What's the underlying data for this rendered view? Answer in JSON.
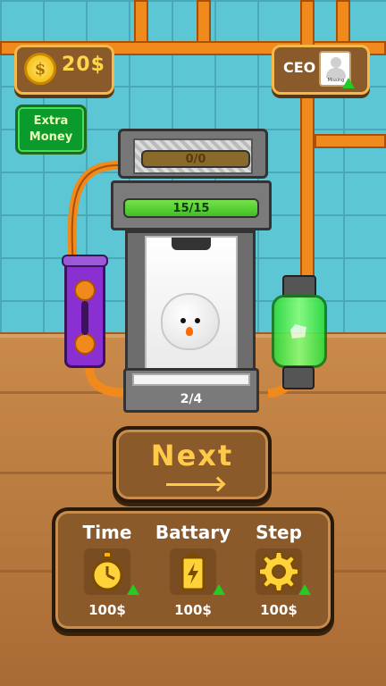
{
  "hud": {
    "coin_symbol": "$",
    "money": "20$",
    "ceo_label": "CEO",
    "avatar_caption": "Missing",
    "extra_money_line1": "Extra",
    "extra_money_line2": "Money"
  },
  "machine": {
    "top_progress": "0/0",
    "top_progress_fraction": 0,
    "energy_progress": "15/15",
    "energy_progress_fraction": 1.0,
    "step_counter": "2/4"
  },
  "next_button": {
    "label": "Next"
  },
  "upgrades": [
    {
      "title": "Time",
      "icon": "stopwatch-icon",
      "price": "100$"
    },
    {
      "title": "Battary",
      "icon": "battery-icon",
      "price": "100$"
    },
    {
      "title": "Step",
      "icon": "gear-icon",
      "price": "100$"
    }
  ],
  "colors": {
    "accent_gold": "#ffc94a",
    "panel_brown": "#8b5a2b",
    "pipe_orange": "#f08a1c",
    "green": "#22cc22"
  }
}
